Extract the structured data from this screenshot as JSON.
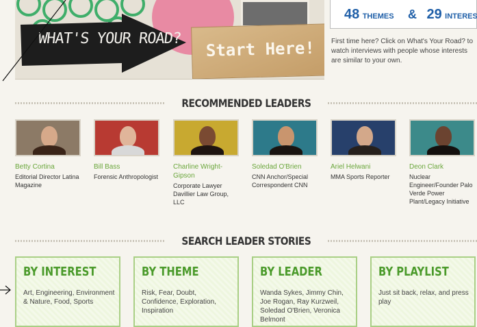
{
  "hero": {
    "road_label": "WHAT'S YOUR ROAD?",
    "start_label": "Start Here!"
  },
  "stats": {
    "themes_count": "48",
    "themes_label": "THEMES",
    "amp": "&",
    "interests_count": "29",
    "interests_label": "INTERESTS"
  },
  "intro": "First time here? Click on What's Your Road? to watch interviews with people whose interests are similar to your own.",
  "recommended": {
    "heading": "RECOMMENDED LEADERS",
    "leaders": [
      {
        "name": "Betty Cortina",
        "role": "Editorial Director Latina Magazine",
        "bg": "#8c7a66",
        "skin": "#d6a98a",
        "hair": "#3a2418"
      },
      {
        "name": "Bill Bass",
        "role": "Forensic Anthropologist",
        "bg": "#b83a32",
        "skin": "#e0b59a",
        "hair": "#d8d8d8"
      },
      {
        "name": "Charline Wright-Gipson",
        "role": "Corporate Lawyer Davillier Law Group, LLC",
        "bg": "#c8a930",
        "skin": "#7a4a32",
        "hair": "#1e1410"
      },
      {
        "name": "Soledad O'Brien",
        "role": "CNN Anchor/Special Correspondent CNN",
        "bg": "#2d7a8a",
        "skin": "#c9956e",
        "hair": "#1a1411"
      },
      {
        "name": "Ariel Helwani",
        "role": "MMA Sports Reporter",
        "bg": "#27406b",
        "skin": "#d3a88a",
        "hair": "#26201c"
      },
      {
        "name": "Deon Clark",
        "role": "Nuclear Engineer/Founder Palo Verde Power Plant/Legacy Initiative",
        "bg": "#3c8a8a",
        "skin": "#6b4330",
        "hair": "#14100e"
      }
    ]
  },
  "search": {
    "heading": "SEARCH LEADER STORIES",
    "boxes": [
      {
        "title": "BY INTEREST",
        "text": "Art, Engineering, Environment & Nature, Food, Sports"
      },
      {
        "title": "BY THEME",
        "text": "Risk, Fear, Doubt, Confidence, Exploration, Inspiration"
      },
      {
        "title": "BY LEADER",
        "text": "Wanda Sykes, Jimmy Chin, Joe Rogan, Ray Kurzweil, Soledad O'Brien, Veronica Belmont"
      },
      {
        "title": "BY PLAYLIST",
        "text": "Just sit back, relax, and press play"
      }
    ]
  },
  "colors": {
    "accent_green": "#6aa63b",
    "heading_green": "#4a9a2a",
    "stat_blue": "#1f5fa8"
  }
}
